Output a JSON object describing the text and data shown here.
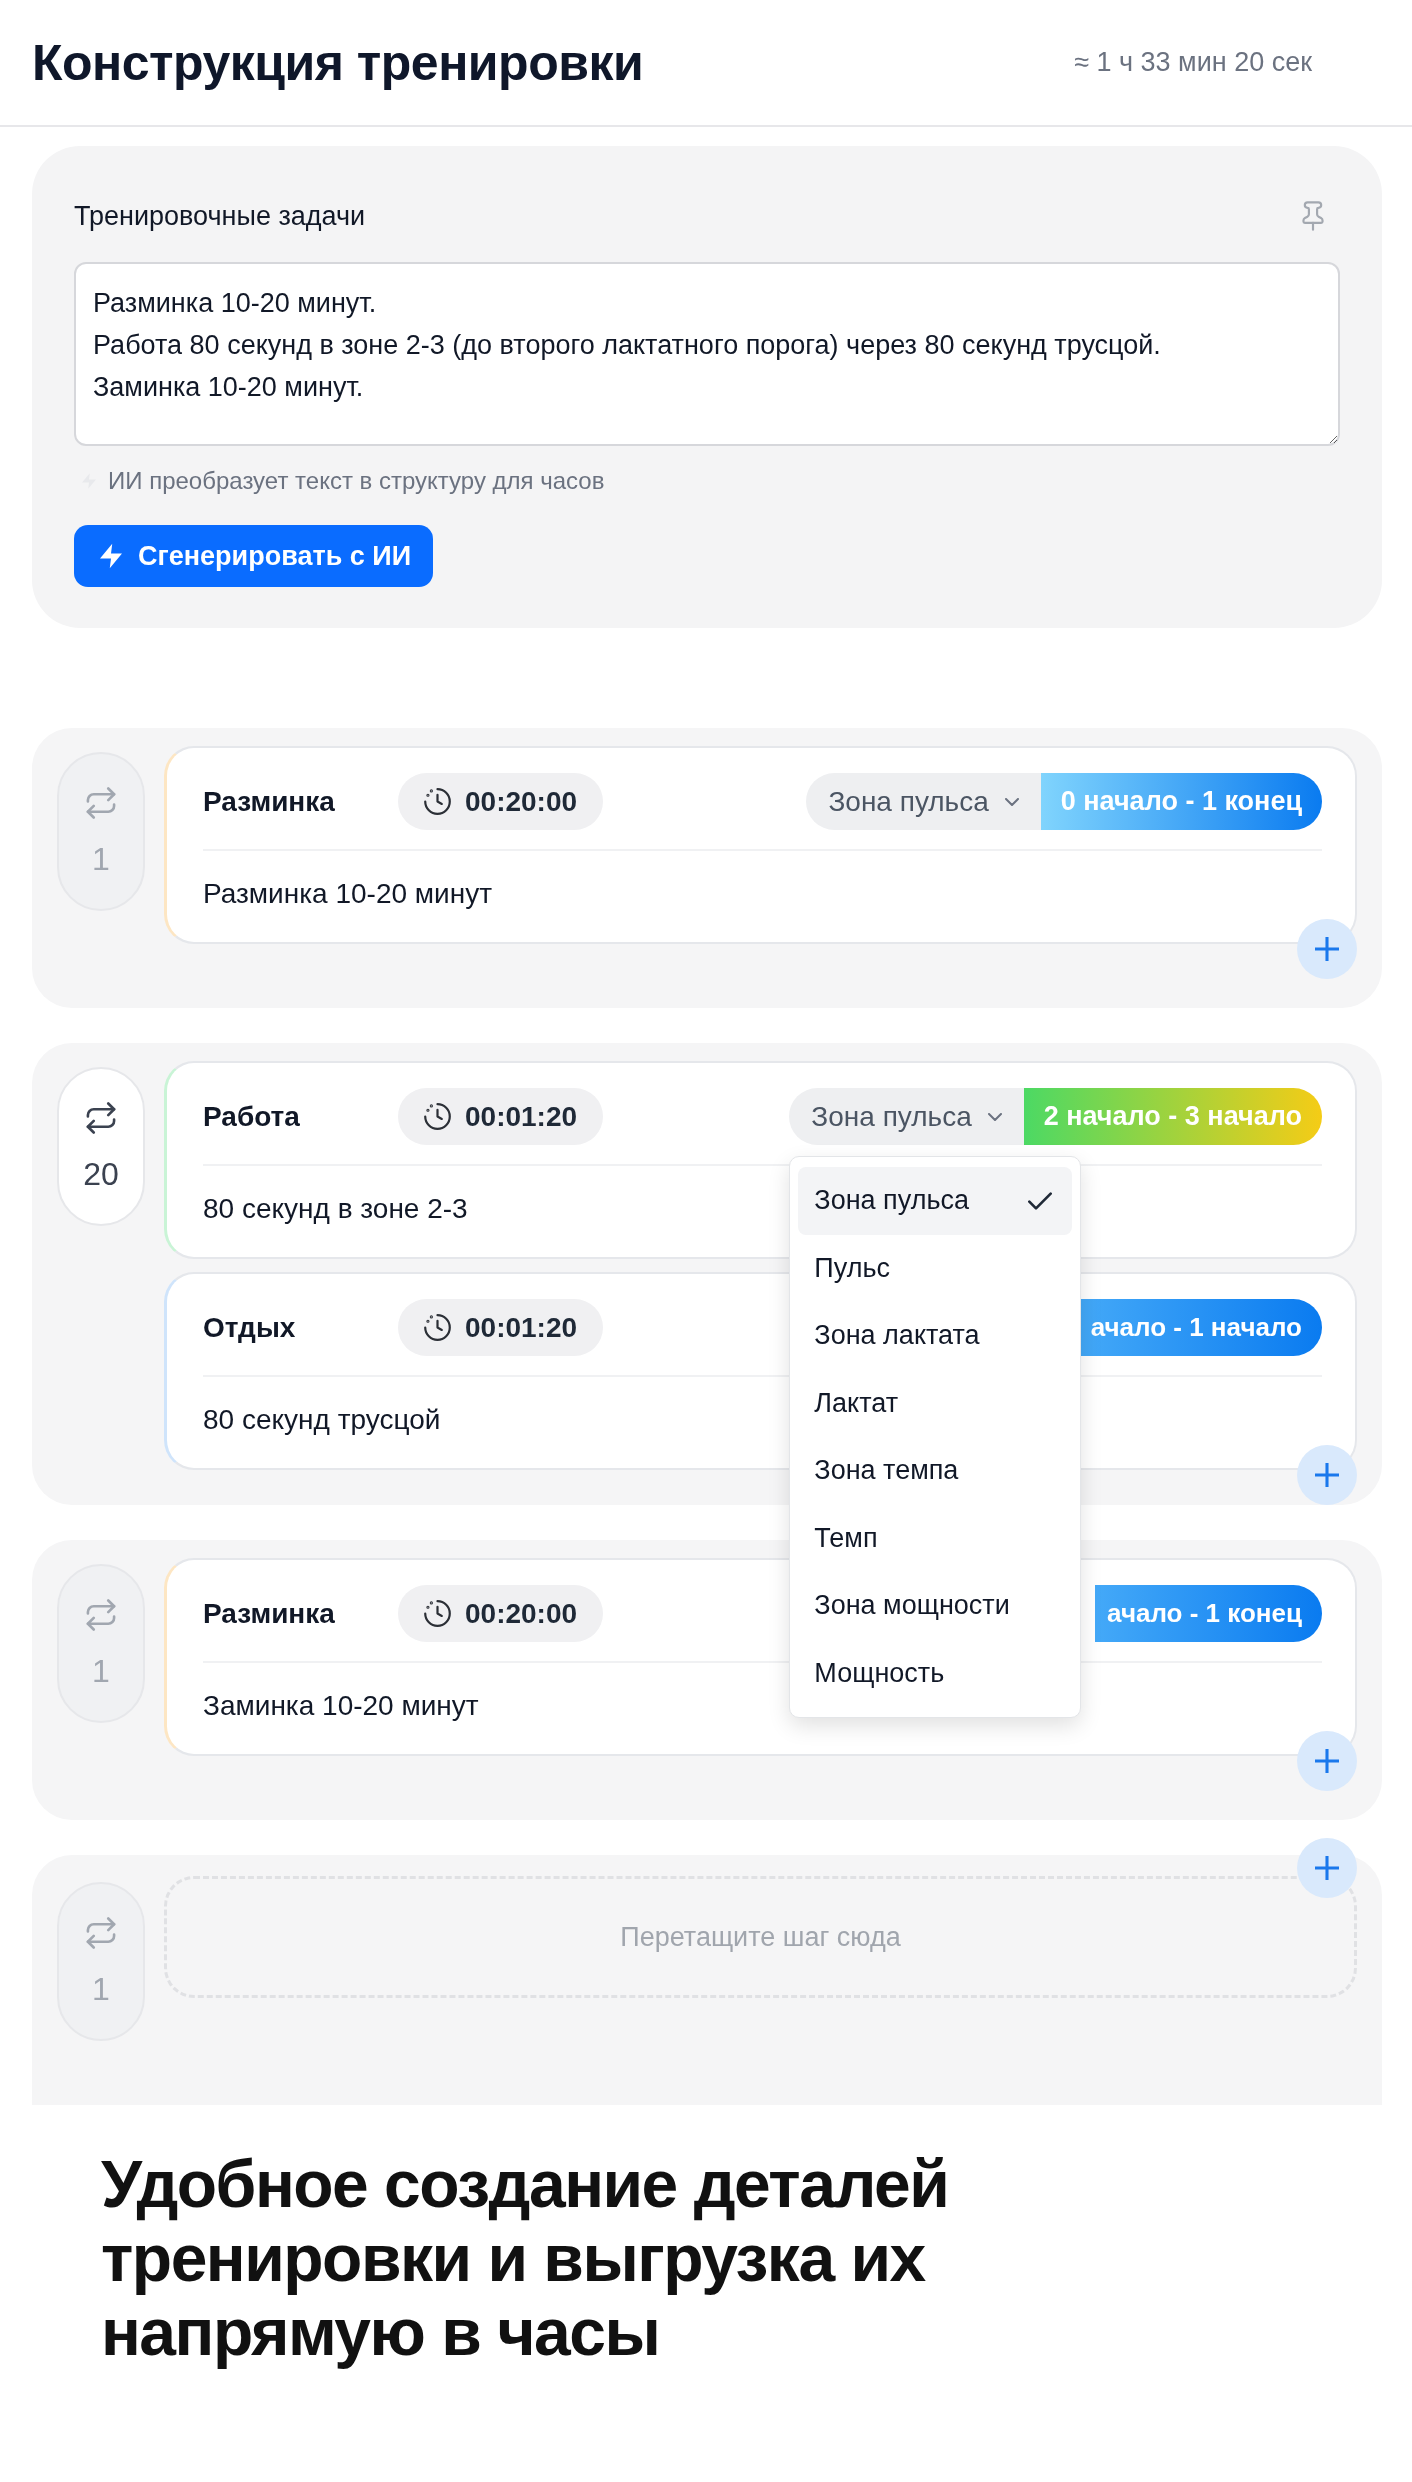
{
  "header": {
    "title": "Конструкция тренировки",
    "duration": "≈ 1 ч 33 мин 20 сек"
  },
  "tasks": {
    "title": "Тренировочные задачи",
    "text": "Разминка 10-20 минут.\nРабота 80 секунд в зоне 2-3 (до второго лактатного порога) через 80 секунд трусцой.\nЗаминка 10-20 минут.",
    "hint": "ИИ преобразует текст в структуру для часов",
    "button": "Сгенерировать с ИИ"
  },
  "blocks": [
    {
      "kind": "steps",
      "repeat": "1",
      "active": false,
      "steps": [
        {
          "name": "Разминка",
          "duration": "00:20:00",
          "color": "#fde6c3",
          "zone_type": "Зона пульса",
          "zone": {
            "label": "0 начало - 1 конец",
            "stops": [
              {
                "color": "#80d4fd"
              },
              {
                "color": "#0a7bf0"
              }
            ]
          },
          "note": "Разминка 10-20 минут"
        }
      ]
    },
    {
      "kind": "steps",
      "repeat": "20",
      "active": true,
      "steps": [
        {
          "name": "Работа",
          "duration": "00:01:20",
          "color": "#c9f4d6",
          "zone_type": "Зона пульса",
          "zone_menu": [
            {
              "label": "Зона пульса",
              "selected": true
            },
            {
              "label": "Пульс",
              "selected": false
            },
            {
              "label": "Зона лактата",
              "selected": false
            },
            {
              "label": "Лактат",
              "selected": false
            },
            {
              "label": "Зона темпа",
              "selected": false
            },
            {
              "label": "Темп",
              "selected": false
            },
            {
              "label": "Зона мощности",
              "selected": false
            },
            {
              "label": "Мощность",
              "selected": false
            }
          ],
          "zone": {
            "label": "2 начало - 3 начало",
            "stops": [
              {
                "color": "#4cd964"
              },
              {
                "color": "#f5cc16"
              }
            ]
          },
          "note": "80 секунд в зоне 2-3"
        },
        {
          "name": "Отдых",
          "duration": "00:01:20",
          "color": "#cfe4fb",
          "zone": {
            "label": "ачало - 1 начало",
            "stops": [
              {
                "color": "#44a9f8"
              },
              {
                "color": "#0a7bf0"
              }
            ]
          },
          "note": "80 секунд трусцой"
        }
      ]
    },
    {
      "kind": "steps",
      "repeat": "1",
      "active": false,
      "steps": [
        {
          "name": "Разминка",
          "duration": "00:20:00",
          "color": "#fde6c3",
          "zone": {
            "label": "ачало - 1 конец",
            "stops": [
              {
                "color": "#44a9f8"
              },
              {
                "color": "#0a7bf0"
              }
            ]
          },
          "note": "Заминка 10-20 минут"
        }
      ]
    },
    {
      "kind": "drop_zone",
      "repeat": "1",
      "active": false,
      "drop_hint": "Перетащите шаг сюда"
    }
  ],
  "caption": "Удобное создание деталей\nтренировки и выгрузка их\nнапрямую в часы"
}
